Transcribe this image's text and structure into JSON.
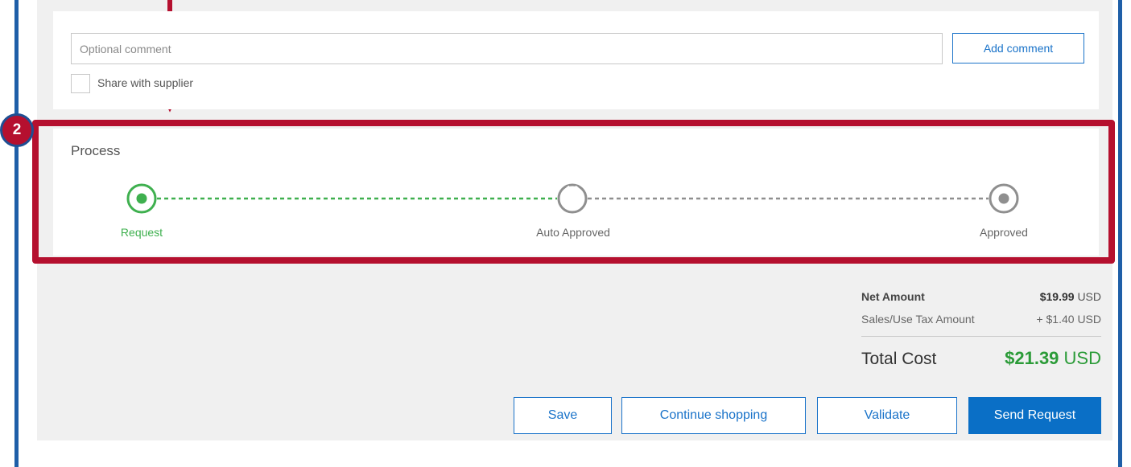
{
  "comment": {
    "placeholder": "Optional comment",
    "value": "",
    "add_button": "Add comment",
    "share_label": "Share with supplier",
    "share_checked": false
  },
  "process": {
    "title": "Process",
    "steps": [
      {
        "label": "Request",
        "state": "current"
      },
      {
        "label": "Auto Approved",
        "state": "pending"
      },
      {
        "label": "Approved",
        "state": "pending"
      }
    ]
  },
  "annotation": {
    "badge_number": "2",
    "highlight_color": "#b5102f"
  },
  "summary": {
    "net_label": "Net Amount",
    "net_amount": "$19.99",
    "net_currency": "USD",
    "tax_label": "Sales/Use Tax Amount",
    "tax_amount": "+ $1.40",
    "tax_currency": "USD",
    "total_label": "Total Cost",
    "total_amount": "$21.39",
    "total_currency": "USD"
  },
  "actions": {
    "save": "Save",
    "continue": "Continue shopping",
    "validate": "Validate",
    "send": "Send Request"
  },
  "colors": {
    "accent_blue": "#0a6fc6",
    "success_green": "#3fb04f",
    "frame_blue": "#1f5fa8"
  }
}
